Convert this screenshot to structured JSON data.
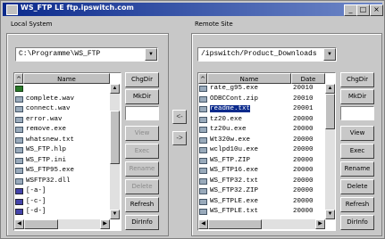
{
  "window": {
    "title": "WS_FTP LE ftp.ipswitch.com",
    "minimize": "_",
    "maximize": "□",
    "close": "×"
  },
  "local": {
    "label": "Local System",
    "path": "C:\\Programme\\WS_FTP",
    "name_header": "Name",
    "files": [
      {
        "name": "",
        "icon": "up-folder-icon"
      },
      {
        "name": "complete.wav",
        "icon": "file-icon"
      },
      {
        "name": "connect.wav",
        "icon": "file-icon"
      },
      {
        "name": "error.wav",
        "icon": "file-icon"
      },
      {
        "name": "remove.exe",
        "icon": "file-icon"
      },
      {
        "name": "whatsnew.txt",
        "icon": "file-icon"
      },
      {
        "name": "WS_FTP.hlp",
        "icon": "file-icon"
      },
      {
        "name": "WS_FTP.ini",
        "icon": "file-icon"
      },
      {
        "name": "WS_FTP95.exe",
        "icon": "file-icon"
      },
      {
        "name": "WSFTP32.dll",
        "icon": "file-icon"
      },
      {
        "name": "[-a-]",
        "icon": "drive-icon"
      },
      {
        "name": "[-c-]",
        "icon": "drive-icon"
      },
      {
        "name": "[-d-]",
        "icon": "drive-icon"
      }
    ],
    "buttons": [
      "ChgDir",
      "MkDir",
      "",
      "View",
      "Exec",
      "Rename",
      "Delete",
      "Refresh",
      "DirInfo"
    ]
  },
  "remote": {
    "label": "Remote Site",
    "path": "/ipswitch/Product_Downloads",
    "name_header": "Name",
    "date_header": "Date",
    "files": [
      {
        "name": "rate_g95.exe",
        "date": "20010",
        "icon": "file-icon"
      },
      {
        "name": "ODBCCont.zip",
        "date": "20010",
        "icon": "file-icon"
      },
      {
        "name": "readme.txt",
        "date": "20001",
        "icon": "file-icon",
        "selected": true
      },
      {
        "name": "tz20.exe",
        "date": "20000",
        "icon": "file-icon"
      },
      {
        "name": "tz20u.exe",
        "date": "20000",
        "icon": "file-icon"
      },
      {
        "name": "Wt320w.exe",
        "date": "20000",
        "icon": "file-icon"
      },
      {
        "name": "wclpd10u.exe",
        "date": "20000",
        "icon": "file-icon"
      },
      {
        "name": "WS_FTP.ZIP",
        "date": "20000",
        "icon": "file-icon"
      },
      {
        "name": "WS_FTP16.exe",
        "date": "20000",
        "icon": "file-icon"
      },
      {
        "name": "WS_FTP32.txt",
        "date": "20000",
        "icon": "file-icon"
      },
      {
        "name": "WS_FTP32.ZIP",
        "date": "20000",
        "icon": "file-icon"
      },
      {
        "name": "WS_FTPLE.exe",
        "date": "20000",
        "icon": "file-icon"
      },
      {
        "name": "WS_FTPLE.txt",
        "date": "20000",
        "icon": "file-icon"
      }
    ],
    "buttons": [
      "ChgDir",
      "MkDir",
      "",
      "View",
      "Exec",
      "Rename",
      "Delete",
      "Refresh",
      "DirInfo"
    ]
  },
  "transfer": {
    "to_local": "<-",
    "to_remote": "->"
  }
}
